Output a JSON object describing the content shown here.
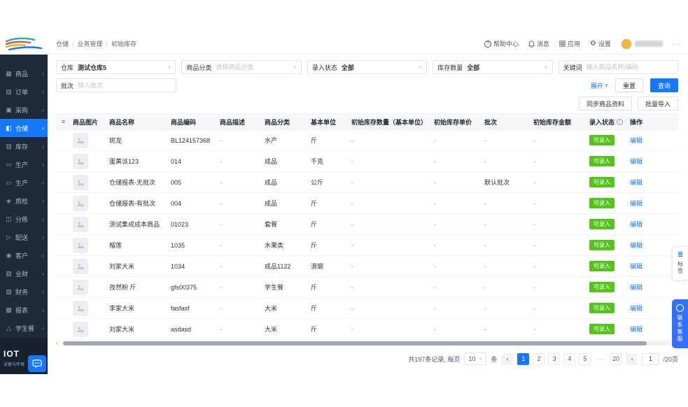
{
  "icons": {
    "chevron_down": "∨",
    "breadcrumb_sep": "/",
    "arrow_right": "›",
    "filter_menu": "≡",
    "info": "i",
    "prev": "‹",
    "next": "›",
    "ellipsis_pages": "···",
    "more": "···",
    "help": "?",
    "gear": "⚙",
    "wave": "≣"
  },
  "breadcrumb": {
    "items": [
      "仓储",
      "业务管理",
      "初始库存"
    ]
  },
  "topbar": {
    "help": "帮助中心",
    "messages": "消息",
    "apps": "应用",
    "settings": "设置"
  },
  "sidebar": {
    "items": [
      {
        "id": "products",
        "label": "商品",
        "glyph": "▦",
        "active": false
      },
      {
        "id": "orders",
        "label": "订单",
        "glyph": "▤",
        "active": false
      },
      {
        "id": "purchase",
        "label": "采购",
        "glyph": "▣",
        "active": false
      },
      {
        "id": "warehouse",
        "label": "仓储",
        "glyph": "◧",
        "active": true
      },
      {
        "id": "inventory",
        "label": "库存",
        "glyph": "▥",
        "active": false
      },
      {
        "id": "production-1",
        "label": "生产",
        "glyph": "▭",
        "active": false
      },
      {
        "id": "production-2",
        "label": "生产",
        "glyph": "▭",
        "active": false
      },
      {
        "id": "quality",
        "label": "质检",
        "glyph": "◈",
        "active": false
      },
      {
        "id": "sorting",
        "label": "分拣",
        "glyph": "◫",
        "active": false
      },
      {
        "id": "delivery",
        "label": "配送",
        "glyph": "▷",
        "active": false
      },
      {
        "id": "customers",
        "label": "客户",
        "glyph": "◉",
        "active": false
      },
      {
        "id": "business-finance",
        "label": "业财",
        "glyph": "▧",
        "active": false
      },
      {
        "id": "finance",
        "label": "财务",
        "glyph": "▨",
        "active": false
      },
      {
        "id": "reports",
        "label": "报表",
        "glyph": "▩",
        "active": false
      },
      {
        "id": "student-meal",
        "label": "学生餐",
        "glyph": "△",
        "active": false
      }
    ],
    "footer": {
      "brand": "IOT",
      "subtitle": "设备与环境"
    }
  },
  "filters": {
    "warehouse_label": "仓库",
    "warehouse_value": "测试仓库5",
    "category_label": "商品分类",
    "category_placeholder": "选择商品分类",
    "status_label": "录入状态",
    "status_value": "全部",
    "qty_label": "库存数量",
    "qty_value": "全部",
    "keyword_label": "关键词",
    "keyword_placeholder": "输入商品名称/编码",
    "batch_label": "批次",
    "batch_placeholder": "输入批次",
    "expand_label": "展开",
    "reset_label": "重置",
    "search_label": "查询"
  },
  "toolbar": {
    "sync_label": "同步商品资料",
    "import_label": "批量导入"
  },
  "table": {
    "headers": [
      "商品图片",
      "商品名称",
      "商品编码",
      "商品描述",
      "商品分类",
      "基本单位",
      "初始库存数量（基本单位）",
      "初始库存单价",
      "批次",
      "初始库存金额",
      "录入状态",
      "操作"
    ],
    "rows": [
      {
        "name": "斑龙",
        "code": "BL124157368",
        "desc": "-",
        "category": "水产",
        "unit": "斤",
        "qty": "-",
        "price": "-",
        "batch": "-",
        "amount": "-",
        "status": "可录入",
        "action": "编辑"
      },
      {
        "name": "蛋黄派123",
        "code": "014",
        "desc": "-",
        "category": "成品",
        "unit": "千克",
        "qty": "-",
        "price": "-",
        "batch": "-",
        "amount": "-",
        "status": "可录入",
        "action": "编辑"
      },
      {
        "name": "仓储报表-无批次",
        "code": "005",
        "desc": "-",
        "category": "成品",
        "unit": "公斤",
        "qty": "-",
        "price": "-",
        "batch": "默认批次",
        "amount": "-",
        "status": "可录入",
        "action": "编辑"
      },
      {
        "name": "仓储报表-有批次",
        "code": "004",
        "desc": "-",
        "category": "成品",
        "unit": "斤",
        "qty": "-",
        "price": "-",
        "batch": "-",
        "amount": "-",
        "status": "可录入",
        "action": "编辑"
      },
      {
        "name": "测试集成成本商品",
        "code": "01023",
        "desc": "-",
        "category": "套餐",
        "unit": "斤",
        "qty": "-",
        "price": "-",
        "batch": "-",
        "amount": "-",
        "status": "可录入",
        "action": "编辑"
      },
      {
        "name": "榴莲",
        "code": "1035",
        "desc": "-",
        "category": "水果类",
        "unit": "斤",
        "qty": "-",
        "price": "-",
        "batch": "-",
        "amount": "-",
        "status": "可录入",
        "action": "编辑"
      },
      {
        "name": "刘家大米",
        "code": "1034",
        "desc": "-",
        "category": "成品1122",
        "unit": "浪琚",
        "qty": "-",
        "price": "-",
        "batch": "-",
        "amount": "-",
        "status": "可录入",
        "action": "编辑"
      },
      {
        "name": "孜然粉 斤",
        "code": "gfs00375",
        "desc": "-",
        "category": "学生餐",
        "unit": "斤",
        "qty": "-",
        "price": "-",
        "batch": "-",
        "amount": "-",
        "status": "可录入",
        "action": "编辑"
      },
      {
        "name": "李家大米",
        "code": "fasfasf",
        "desc": "-",
        "category": "大米",
        "unit": "斤",
        "qty": "-",
        "price": "-",
        "batch": "-",
        "amount": "-",
        "status": "可录入",
        "action": "编辑"
      },
      {
        "name": "刘家大米",
        "code": "asdasd",
        "desc": "-",
        "category": "大米",
        "unit": "斤",
        "qty": "-",
        "price": "-",
        "batch": "-",
        "amount": "-",
        "status": "可录入",
        "action": "编辑"
      }
    ]
  },
  "pagination": {
    "total_text": "共197条记录, 每页",
    "page_size": "10",
    "size_suffix": "条",
    "pages": [
      "1",
      "2",
      "3",
      "4",
      "5",
      "···",
      "20"
    ],
    "jump_value": "1",
    "jump_suffix": "/20页"
  },
  "floating": {
    "tag_label": "标签",
    "service_label": "联系客服"
  }
}
